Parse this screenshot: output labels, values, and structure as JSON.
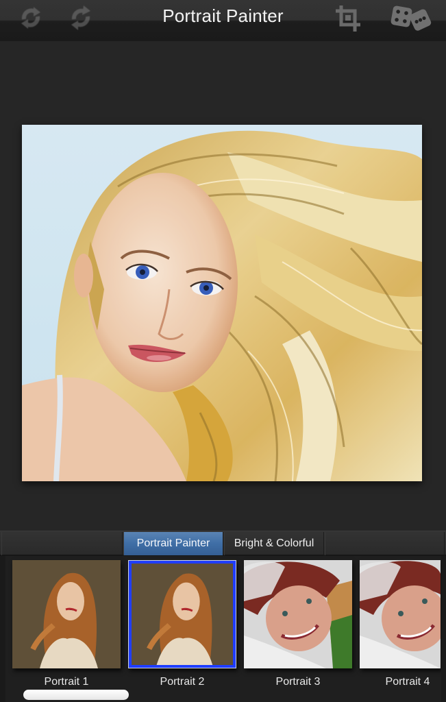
{
  "header": {
    "title": "Portrait Painter",
    "icons": [
      "undo-icon",
      "redo-icon",
      "crop-icon",
      "dice-icon"
    ]
  },
  "canvas": {
    "description": "Painted portrait of a blonde woman with wind-blown hair and blue eyes against a pale blue sky"
  },
  "tabs": [
    {
      "label": "Portrait Painter",
      "active": true
    },
    {
      "label": "Bright & Colorful",
      "active": false
    }
  ],
  "presets": [
    {
      "label": "Portrait 1",
      "selected": false,
      "subject": "auburn-haired woman in white top, brown background"
    },
    {
      "label": "Portrait 2",
      "selected": true,
      "subject": "auburn-haired woman in white top, brown background"
    },
    {
      "label": "Portrait 3",
      "selected": false,
      "subject": "smiling woman in red knit hat in snow"
    },
    {
      "label": "Portrait 4",
      "selected": false,
      "subject": "smiling woman in red knit hat in snow"
    }
  ],
  "colors": {
    "accent_tab": "#3f6ea6",
    "selection_border": "#1f3dff",
    "background": "#262626"
  },
  "scroll": {
    "position": 0
  }
}
